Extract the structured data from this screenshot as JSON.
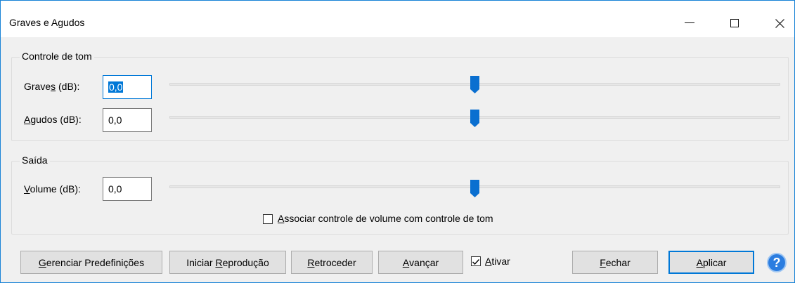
{
  "window": {
    "title": "Graves e Agudos",
    "controls": {
      "minimize": "—",
      "maximize": "☐",
      "close": "✕"
    }
  },
  "tone_group": {
    "legend": "Controle de tom",
    "bass": {
      "label_pre": "Grave",
      "label_mn": "s",
      "label_post": " (dB):",
      "value": "0,0",
      "slider_position_fraction": 0.5
    },
    "treble": {
      "label_pre": "",
      "label_mn": "A",
      "label_post": "gudos (dB):",
      "value": "0,0",
      "slider_position_fraction": 0.5
    }
  },
  "output_group": {
    "legend": "Saída",
    "volume": {
      "label_pre": "",
      "label_mn": "V",
      "label_post": "olume (dB):",
      "value": "0,0",
      "slider_position_fraction": 0.5
    },
    "link_checkbox": {
      "label_pre": "",
      "label_mn": "A",
      "label_post": "ssociar controle de volume com controle de tom",
      "checked": false
    }
  },
  "buttons": {
    "manage_presets": {
      "pre": "",
      "mn": "G",
      "post": "erenciar Predefinições"
    },
    "start_playback": {
      "pre": "Iniciar ",
      "mn": "R",
      "post": "eprodução"
    },
    "rewind": {
      "pre": "",
      "mn": "R",
      "post": "etroceder"
    },
    "forward": {
      "pre": "",
      "mn": "A",
      "post": "vançar"
    },
    "enable": {
      "pre": "",
      "mn": "A",
      "post": "tivar",
      "checked": true
    },
    "close": {
      "pre": "",
      "mn": "F",
      "post": "echar"
    },
    "apply": {
      "pre": "",
      "mn": "A",
      "post": "plicar"
    },
    "help": "?"
  },
  "colors": {
    "accent": "#0078d7",
    "thumb": "#0a6fd0",
    "help": "#2b7de0"
  }
}
